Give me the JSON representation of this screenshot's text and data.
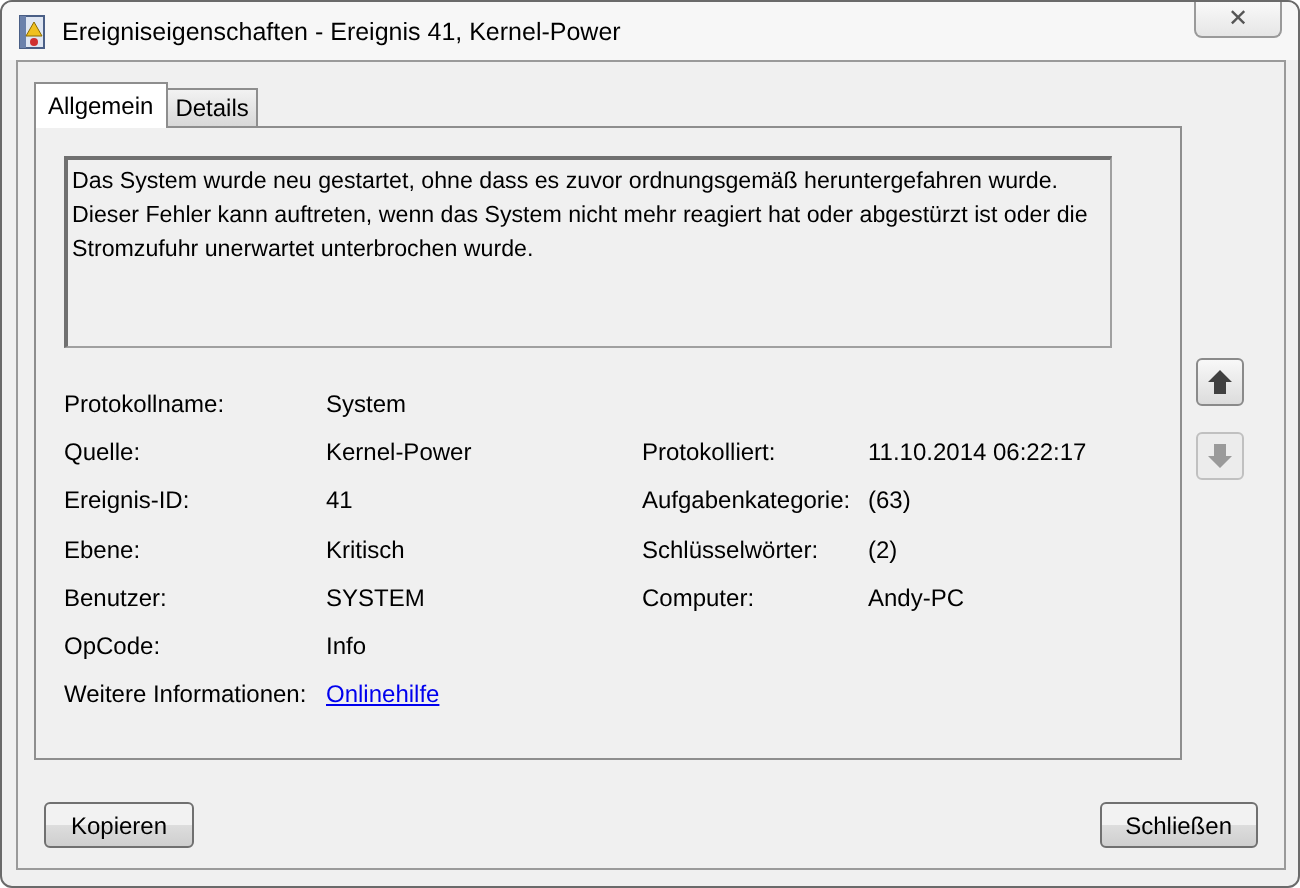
{
  "window": {
    "title": "Ereigniseigenschaften - Ereignis 41, Kernel-Power",
    "close": "✕"
  },
  "tabs": [
    {
      "label": "Allgemein",
      "selected": true
    },
    {
      "label": "Details",
      "selected": false
    }
  ],
  "description": "Das System wurde neu gestartet, ohne dass es zuvor ordnungsgemäß heruntergefahren wurde. Dieser Fehler kann auftreten, wenn das System nicht mehr reagiert hat oder abgestürzt ist oder die Stromzufuhr unerwartet unterbrochen wurde.",
  "properties": [
    {
      "label": "Protokollname:",
      "value": "System"
    },
    {
      "label": "Quelle:",
      "value": "Kernel-Power",
      "right_label": "Protokolliert:",
      "right_value": "11.10.2014 06:22:17"
    },
    {
      "label": "Ereignis-ID:",
      "value": "41",
      "right_label": "Aufgabenkategorie:",
      "right_value": "(63)"
    },
    {
      "label": "Ebene:",
      "value": "Kritisch",
      "right_label": "Schlüsselwörter:",
      "right_value": "(2)"
    },
    {
      "label": "Benutzer:",
      "value": "SYSTEM",
      "right_label": "Computer:",
      "right_value": "Andy-PC"
    },
    {
      "label": "OpCode:",
      "value": "Info"
    },
    {
      "label": "Weitere Informationen:",
      "value": "Onlinehilfe",
      "kind": "link"
    }
  ],
  "navigation": [
    {
      "kind": "up",
      "disabled": false
    },
    {
      "kind": "down",
      "disabled": true
    }
  ],
  "buttons": [
    "Kopieren",
    "Schließen"
  ]
}
